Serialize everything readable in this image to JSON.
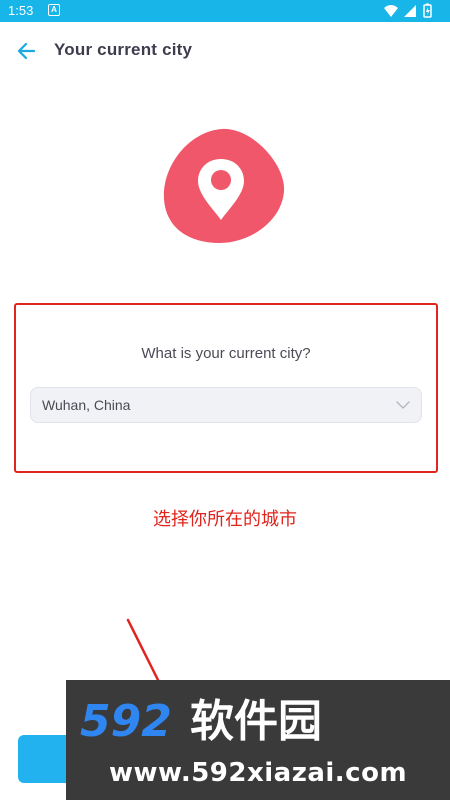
{
  "status_bar": {
    "time": "1:53",
    "notification_letter": "A",
    "icons": [
      "wifi-icon",
      "signal-icon",
      "battery-icon"
    ],
    "color": "#17b5e8"
  },
  "header": {
    "title": "Your current city",
    "back_icon": "arrow-left-icon"
  },
  "hero": {
    "icon": "location-pin-icon",
    "color": "#f0576a"
  },
  "form": {
    "question": "What is your current city?",
    "city_select": {
      "value": "Wuhan, China",
      "icon": "chevron-down-icon"
    }
  },
  "annotation": {
    "text": "选择你所在的城市",
    "color": "#e0241e"
  },
  "continue_button": {
    "color": "#22b2f0"
  },
  "watermark": {
    "logo_text": "592软件园",
    "url": "www.592xiazai.com"
  }
}
